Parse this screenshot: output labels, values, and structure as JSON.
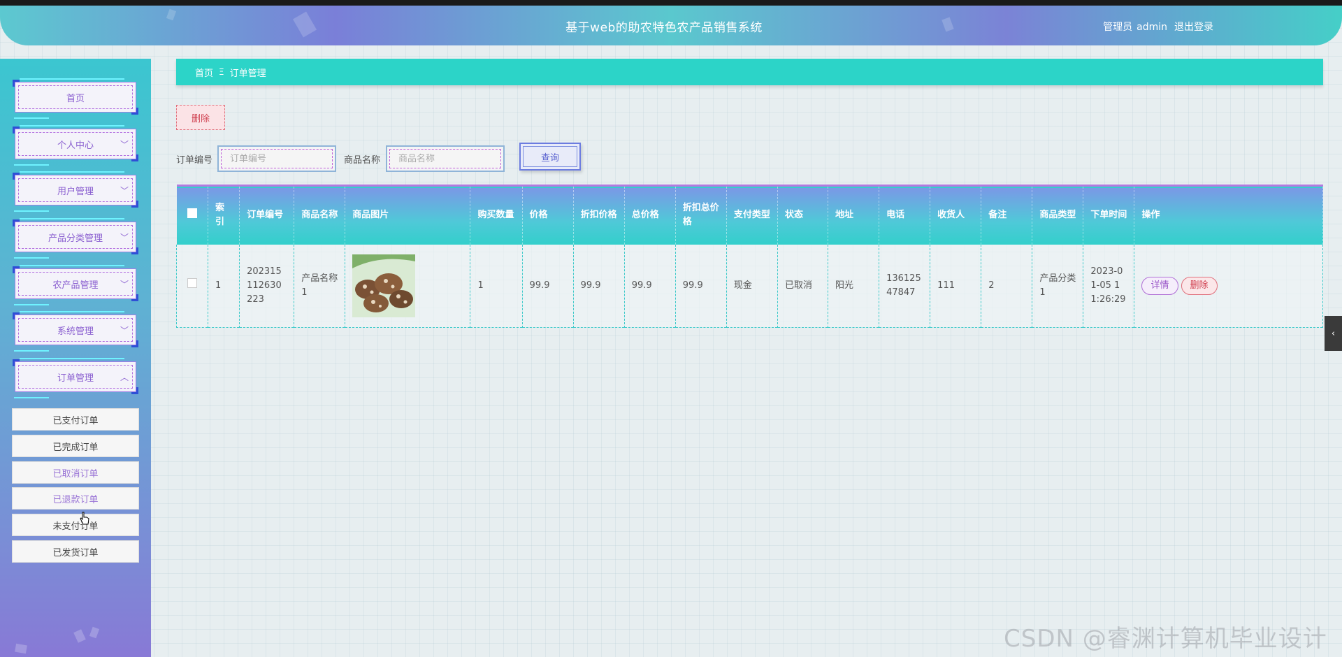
{
  "header": {
    "title": "基于web的助农特色农产品销售系统",
    "role": "管理员",
    "username": "admin",
    "logout": "退出登录"
  },
  "sidebar": {
    "items": [
      {
        "label": "首页"
      },
      {
        "label": "个人中心"
      },
      {
        "label": "用户管理"
      },
      {
        "label": "产品分类管理"
      },
      {
        "label": "农产品管理"
      },
      {
        "label": "系统管理"
      },
      {
        "label": "订单管理"
      }
    ],
    "sub_items": [
      {
        "label": "已支付订单"
      },
      {
        "label": "已完成订单"
      },
      {
        "label": "已取消订单"
      },
      {
        "label": "已退款订单"
      },
      {
        "label": "未支付订单"
      },
      {
        "label": "已发货订单"
      }
    ]
  },
  "breadcrumb": {
    "home": "首页",
    "separator": "Ξ",
    "current": "订单管理"
  },
  "toolbar": {
    "delete_label": "删除"
  },
  "search": {
    "order_no_label": "订单编号",
    "order_no_placeholder": "订单编号",
    "product_name_label": "商品名称",
    "product_name_placeholder": "商品名称",
    "query_label": "查询"
  },
  "table": {
    "headers": [
      "索引",
      "订单编号",
      "商品名称",
      "商品图片",
      "购买数量",
      "价格",
      "折扣价格",
      "总价格",
      "折扣总价格",
      "支付类型",
      "状态",
      "地址",
      "电话",
      "收货人",
      "备注",
      "商品类型",
      "下单时间",
      "操作"
    ],
    "rows": [
      {
        "index": "1",
        "order_no": "202315112630223",
        "product_name": "产品名称1",
        "quantity": "1",
        "price": "99.9",
        "discount_price": "99.9",
        "total_price": "99.9",
        "discount_total": "99.9",
        "pay_type": "现金",
        "status": "已取消",
        "address": "阳光",
        "phone": "13612547847",
        "receiver": "111",
        "remark": "2",
        "product_type": "产品分类1",
        "order_time": "2023-01-05 11:26:29",
        "detail_label": "详情",
        "delete_label": "删除"
      }
    ]
  },
  "watermark": "CSDN @睿渊计算机毕业设计",
  "colors": {
    "accent": "#2cd4c8",
    "purple": "#8a5fd0",
    "danger": "#d04050"
  }
}
